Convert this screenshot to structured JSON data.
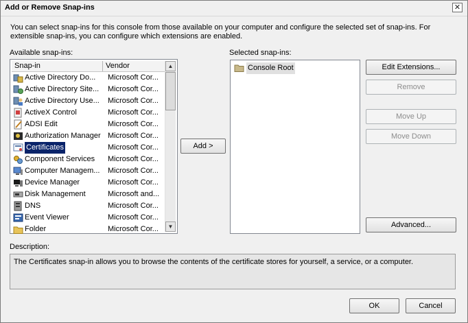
{
  "window": {
    "title": "Add or Remove Snap-ins",
    "close_glyph": "✕"
  },
  "intro": "You can select snap-ins for this console from those available on your computer and configure the selected set of snap-ins. For extensible snap-ins, you can configure which extensions are enabled.",
  "available": {
    "label": "Available snap-ins:",
    "col_snapin": "Snap-in",
    "col_vendor": "Vendor",
    "items": [
      {
        "name": "Active Directory Do...",
        "vendor": "Microsoft Cor...",
        "icon": "ad-domains-icon"
      },
      {
        "name": "Active Directory Site...",
        "vendor": "Microsoft Cor...",
        "icon": "ad-sites-icon"
      },
      {
        "name": "Active Directory Use...",
        "vendor": "Microsoft Cor...",
        "icon": "ad-users-icon"
      },
      {
        "name": "ActiveX Control",
        "vendor": "Microsoft Cor...",
        "icon": "activex-icon"
      },
      {
        "name": "ADSI Edit",
        "vendor": "Microsoft Cor...",
        "icon": "adsi-edit-icon"
      },
      {
        "name": "Authorization Manager",
        "vendor": "Microsoft Cor...",
        "icon": "authorization-icon"
      },
      {
        "name": "Certificates",
        "vendor": "Microsoft Cor...",
        "icon": "certificates-icon",
        "selected": true
      },
      {
        "name": "Component Services",
        "vendor": "Microsoft Cor...",
        "icon": "component-services-icon"
      },
      {
        "name": "Computer Managem...",
        "vendor": "Microsoft Cor...",
        "icon": "computer-management-icon"
      },
      {
        "name": "Device Manager",
        "vendor": "Microsoft Cor...",
        "icon": "device-manager-icon"
      },
      {
        "name": "Disk Management",
        "vendor": "Microsoft and...",
        "icon": "disk-management-icon"
      },
      {
        "name": "DNS",
        "vendor": "Microsoft Cor...",
        "icon": "dns-icon"
      },
      {
        "name": "Event Viewer",
        "vendor": "Microsoft Cor...",
        "icon": "event-viewer-icon"
      },
      {
        "name": "Folder",
        "vendor": "Microsoft Cor...",
        "icon": "folder-icon"
      }
    ]
  },
  "add_button": "Add >",
  "selected": {
    "label": "Selected snap-ins:",
    "items": [
      {
        "name": "Console Root",
        "icon": "folder-icon"
      }
    ]
  },
  "buttons": {
    "edit_extensions": "Edit Extensions...",
    "remove": "Remove",
    "move_up": "Move Up",
    "move_down": "Move Down",
    "advanced": "Advanced...",
    "ok": "OK",
    "cancel": "Cancel"
  },
  "description": {
    "label": "Description:",
    "text": "The Certificates snap-in allows you to browse the contents of the certificate stores for yourself, a service, or a computer."
  }
}
